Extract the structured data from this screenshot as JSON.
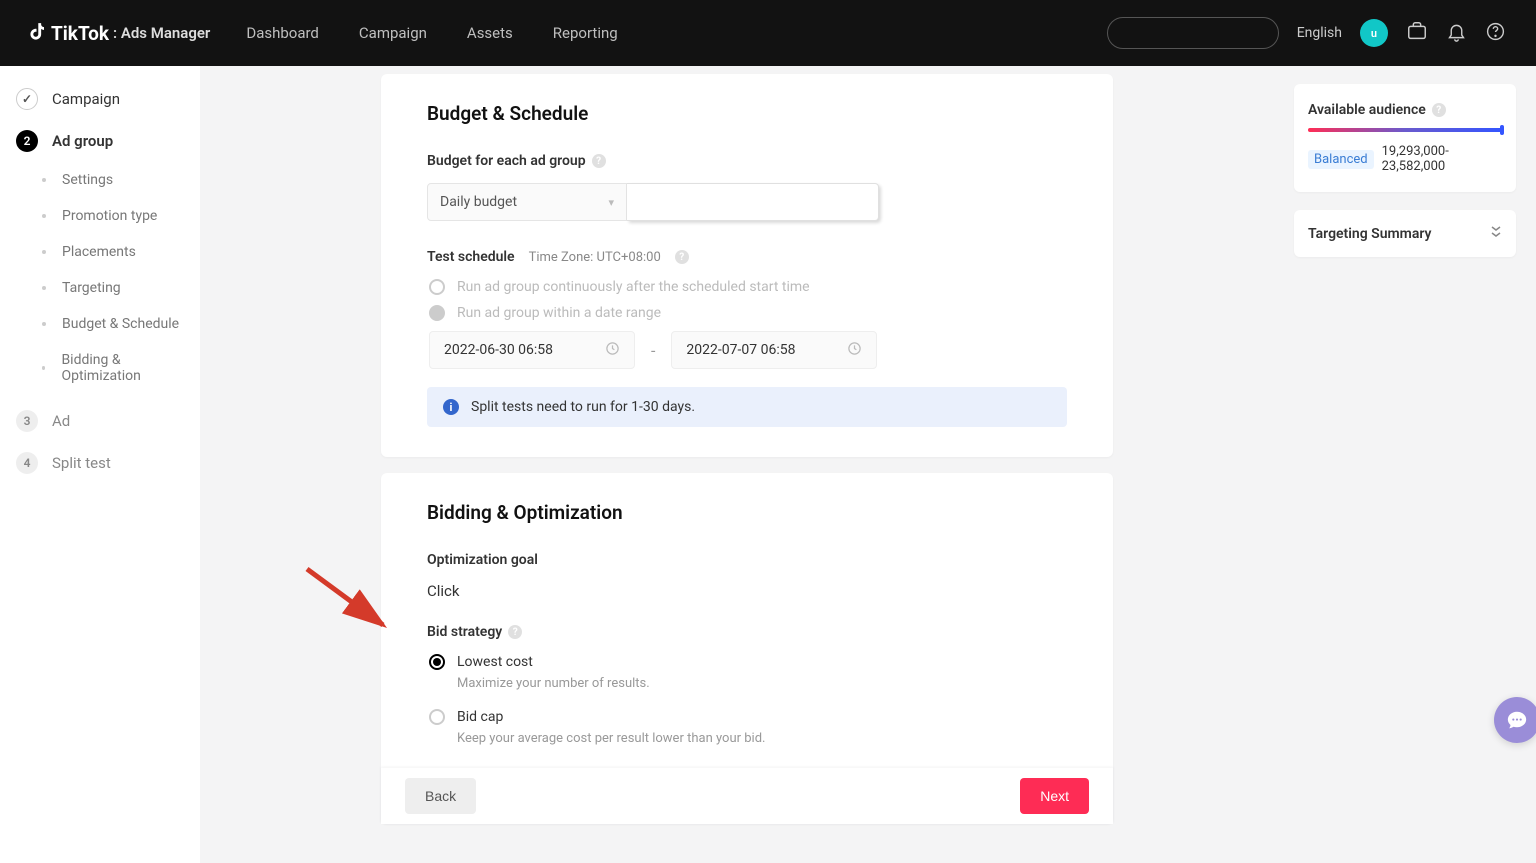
{
  "header": {
    "logo": "TikTok",
    "logo_sub": ": Ads Manager",
    "nav": [
      "Dashboard",
      "Campaign",
      "Assets",
      "Reporting"
    ],
    "lang": "English",
    "avatar_initial": "u"
  },
  "sidebar": {
    "steps": [
      {
        "badge": "✓",
        "label": "Campaign",
        "state": "done"
      },
      {
        "badge": "2",
        "label": "Ad group",
        "state": "active"
      },
      {
        "badge": "3",
        "label": "Ad",
        "state": "future"
      },
      {
        "badge": "4",
        "label": "Split test",
        "state": "future"
      }
    ],
    "substeps": [
      "Settings",
      "Promotion type",
      "Placements",
      "Targeting",
      "Budget & Schedule",
      "Bidding & Optimization"
    ]
  },
  "budget_schedule": {
    "title": "Budget & Schedule",
    "budget_label": "Budget for each ad group",
    "select_value": "Daily budget",
    "schedule_label": "Test schedule",
    "timezone": "Time Zone: UTC+08:00",
    "radio1": "Run ad group continuously after the scheduled start time",
    "radio2": "Run ad group within a date range",
    "start": "2022-06-30 06:58",
    "end": "2022-07-07 06:58",
    "info": "Split tests need to run for 1-30 days."
  },
  "bidding": {
    "title": "Bidding & Optimization",
    "goal_label": "Optimization goal",
    "goal_value": "Click",
    "strategy_label": "Bid strategy",
    "opt1": "Lowest cost",
    "opt1_desc": "Maximize your number of results.",
    "opt2": "Bid cap",
    "opt2_desc": "Keep your average cost per result lower than your bid."
  },
  "footer": {
    "back": "Back",
    "next": "Next"
  },
  "right": {
    "audience_title": "Available audience",
    "balanced": "Balanced",
    "range": "19,293,000-23,582,000",
    "targeting_title": "Targeting Summary"
  }
}
